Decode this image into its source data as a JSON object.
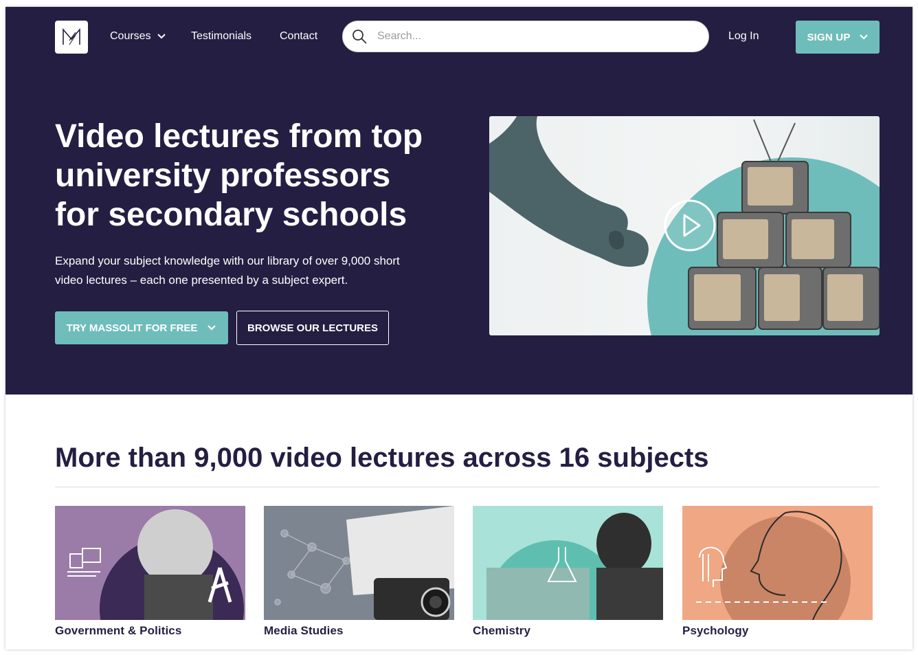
{
  "colors": {
    "navy": "#241e42",
    "teal": "#6fbdba",
    "white": "#ffffff",
    "purple": "#9b7ba8",
    "slate": "#7c8590",
    "mint": "#a9e2d8",
    "peach": "#f0a783"
  },
  "nav": {
    "logo_icon": "massolit-m-icon",
    "courses": "Courses",
    "testimonials": "Testimonials",
    "contact": "Contact",
    "search_placeholder": "Search...",
    "login": "Log In",
    "signup": "SIGN UP"
  },
  "hero": {
    "title_line1": "Video lectures from top",
    "title_line2": "university professors",
    "title_line3": "for secondary schools",
    "subtitle_line1": "Expand your subject knowledge with our library of over 9,000 short",
    "subtitle_line2": "video lectures – each one presented by a subject expert.",
    "try_button": "TRY MASSOLIT FOR FREE",
    "browse_button": "BROWSE OUR LECTURES",
    "video_icon": "play-icon"
  },
  "subjects": {
    "title": "More than 9,000 video lectures across 16 subjects",
    "items": [
      {
        "label": "Government & Politics",
        "icon": "ballot-box-icon"
      },
      {
        "label": "Media Studies",
        "icon": "camera-icon"
      },
      {
        "label": "Chemistry",
        "icon": "flask-icon"
      },
      {
        "label": "Psychology",
        "icon": "head-icon"
      }
    ]
  }
}
